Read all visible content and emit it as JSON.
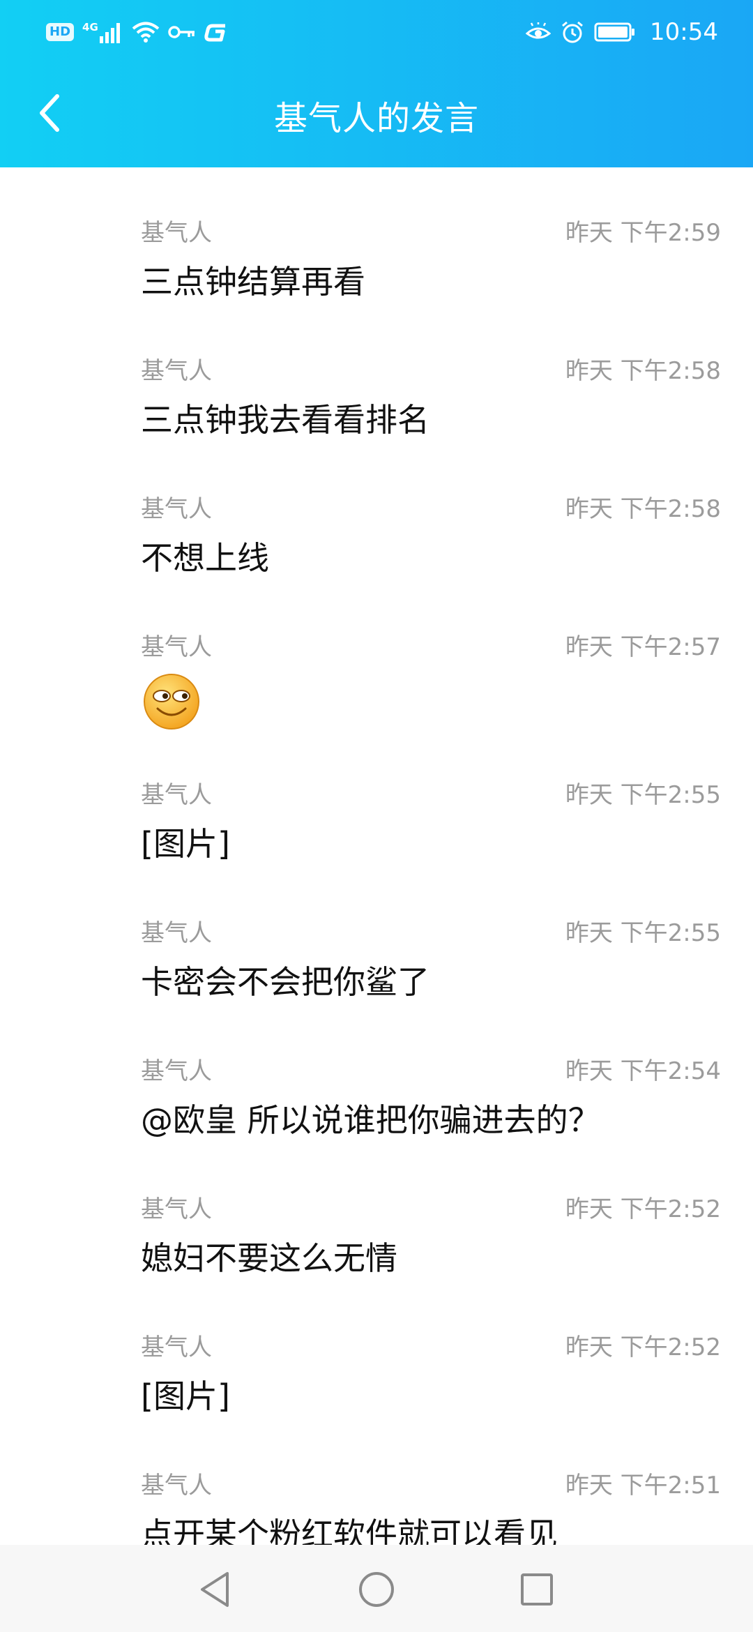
{
  "statusbar": {
    "hd": "HD",
    "network": "4G",
    "time": "10:54"
  },
  "header": {
    "title": "基气人的发言"
  },
  "messages": [
    {
      "name": "基气人",
      "time": "昨天 下午2:59",
      "text": "三点钟结算再看"
    },
    {
      "name": "基气人",
      "time": "昨天 下午2:58",
      "text": "三点钟我去看看排名"
    },
    {
      "name": "基气人",
      "time": "昨天 下午2:58",
      "text": "不想上线"
    },
    {
      "name": "基气人",
      "time": "昨天 下午2:57",
      "text": "",
      "icon": "smiling-emoji-icon"
    },
    {
      "name": "基气人",
      "time": "昨天 下午2:55",
      "text": "[图片]"
    },
    {
      "name": "基气人",
      "time": "昨天 下午2:55",
      "text": "卡密会不会把你鲨了"
    },
    {
      "name": "基气人",
      "time": "昨天 下午2:54",
      "text": "@欧皇 所以说谁把你骗进去的？"
    },
    {
      "name": "基气人",
      "time": "昨天 下午2:52",
      "text": "媳妇不要这么无情"
    },
    {
      "name": "基气人",
      "time": "昨天 下午2:52",
      "text": "[图片]"
    },
    {
      "name": "基气人",
      "time": "昨天 下午2:51",
      "text": "点开某个粉红软件就可以看见"
    }
  ],
  "colors": {
    "header_start": "#12cff4",
    "header_end": "#1aa7f5",
    "meta_text": "#9b9b9b",
    "body_text": "#111111"
  }
}
